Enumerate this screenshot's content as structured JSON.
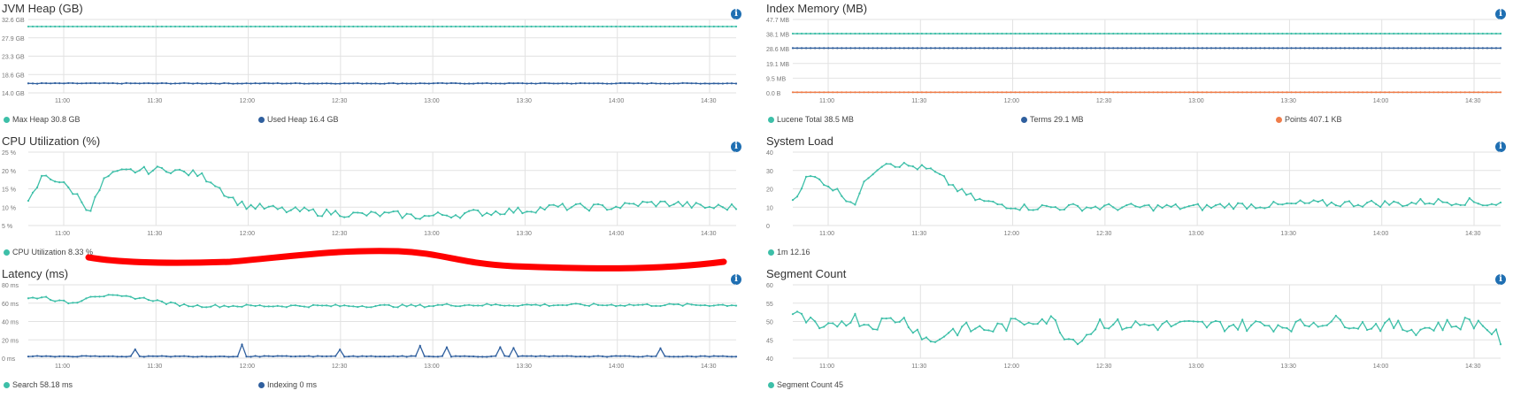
{
  "panels": [
    {
      "id": "jvm-heap",
      "title": "JVM Heap (GB)",
      "chart_data": {
        "type": "line",
        "title": "JVM Heap (GB)",
        "x": [
          "11:00",
          "11:30",
          "12:00",
          "12:30",
          "13:00",
          "13:30",
          "14:00",
          "14:30"
        ],
        "y_ticks": [
          "14.0 GB",
          "18.6 GB",
          "23.3 GB",
          "27.9 GB",
          "32.6 GB"
        ],
        "ylim": [
          14.0,
          32.6
        ],
        "series": [
          {
            "name": "Max Heap",
            "legend": "Max Heap 30.8 GB",
            "color": "#3dbfa8",
            "level": 30.8,
            "noise": 0.0
          },
          {
            "name": "Used Heap",
            "legend": "Used Heap 16.4 GB",
            "color": "#2f5f9e",
            "level": 16.4,
            "noise": 0.18
          }
        ]
      }
    },
    {
      "id": "index-memory",
      "title": "Index Memory (MB)",
      "chart_data": {
        "type": "line",
        "title": "Index Memory (MB)",
        "x": [
          "11:00",
          "11:30",
          "12:00",
          "12:30",
          "13:00",
          "13:30",
          "14:00",
          "14:30"
        ],
        "y_ticks": [
          "0.0 B",
          "9.5 MB",
          "19.1 MB",
          "28.6 MB",
          "38.1 MB",
          "47.7 MB"
        ],
        "ylim": [
          0,
          47.7
        ],
        "series": [
          {
            "name": "Lucene Total",
            "legend": "Lucene Total 38.5 MB",
            "color": "#3dbfa8",
            "level": 38.5,
            "noise": 0.0
          },
          {
            "name": "Terms",
            "legend": "Terms 29.1 MB",
            "color": "#2f5f9e",
            "level": 29.1,
            "noise": 0.0
          },
          {
            "name": "Points",
            "legend": "Points 407.1 KB",
            "color": "#ef7d4a",
            "level": 0.4,
            "noise": 0.0
          }
        ]
      }
    },
    {
      "id": "cpu-utilization",
      "title": "CPU Utilization (%)",
      "chart_data": {
        "type": "line",
        "title": "CPU Utilization (%)",
        "x": [
          "11:00",
          "11:30",
          "12:00",
          "12:30",
          "13:00",
          "13:30",
          "14:00",
          "14:30"
        ],
        "y_ticks": [
          "5 %",
          "10 %",
          "15 %",
          "20 %",
          "25 %"
        ],
        "ylim": [
          5,
          25
        ],
        "series": [
          {
            "name": "CPU Utilization",
            "legend": "CPU Utilization 8.33 %",
            "color": "#3dbfa8",
            "profile": [
              11,
              19,
              17,
              14,
              9,
              18,
              19.5,
              20,
              20,
              20.5,
              19.5,
              19,
              17,
              13,
              10.5,
              10,
              9.5,
              9,
              9,
              8.5,
              8.5,
              8,
              8,
              8,
              8,
              7.5,
              7.5,
              8,
              8,
              8.5,
              8.5,
              9,
              9,
              9.5,
              10,
              10,
              10,
              10,
              10,
              10.5,
              11,
              11,
              11,
              10.5,
              10,
              10,
              10
            ],
            "noise": 2.0
          }
        ]
      }
    },
    {
      "id": "system-load",
      "title": "System Load",
      "chart_data": {
        "type": "line",
        "title": "System Load",
        "x": [
          "11:00",
          "11:30",
          "12:00",
          "12:30",
          "13:00",
          "13:30",
          "14:00",
          "14:30"
        ],
        "y_ticks": [
          "0",
          "10",
          "20",
          "30",
          "40"
        ],
        "ylim": [
          0,
          40
        ],
        "series": [
          {
            "name": "1m",
            "legend": "1m 12.16",
            "color": "#3dbfa8",
            "profile": [
              14,
              27,
              24,
              18,
              12,
              28,
              35,
              33,
              32,
              30,
              24,
              18,
              14,
              12,
              11,
              10,
              10,
              10,
              10,
              10,
              10,
              10,
              10,
              10,
              10,
              10,
              10,
              10,
              11,
              11,
              11,
              11,
              11,
              12,
              12,
              12,
              12,
              12,
              12,
              12,
              12,
              13,
              13,
              13,
              13,
              12,
              12
            ],
            "noise": 4.0
          }
        ]
      }
    },
    {
      "id": "latency",
      "title": "Latency (ms)",
      "chart_data": {
        "type": "line",
        "title": "Latency (ms)",
        "x": [
          "11:00",
          "11:30",
          "12:00",
          "12:30",
          "13:00",
          "13:30",
          "14:00",
          "14:30"
        ],
        "y_ticks": [
          "0 ms",
          "20 ms",
          "40 ms",
          "60 ms",
          "80 ms"
        ],
        "ylim": [
          0,
          80
        ],
        "series": [
          {
            "name": "Search",
            "legend": "Search 58.18 ms",
            "color": "#3dbfa8",
            "profile": [
              65,
              67,
              62,
              60,
              68,
              68,
              67,
              66,
              64,
              60,
              58,
              57,
              57,
              57,
              57,
              57,
              57,
              57,
              57,
              57,
              57,
              57,
              57,
              57,
              57,
              57,
              57,
              58,
              58,
              58,
              58,
              58,
              58,
              58,
              58,
              58,
              58,
              58,
              58,
              58,
              58,
              58,
              58,
              58,
              58,
              58,
              58
            ],
            "noise": 3.0
          },
          {
            "name": "Indexing",
            "legend": "Indexing 0 ms",
            "color": "#2f5f9e",
            "profile": [
              2,
              2,
              2,
              2,
              2,
              2,
              2,
              2,
              2,
              2,
              2,
              2,
              2,
              2,
              2,
              2,
              2,
              2,
              2,
              2,
              2,
              2,
              2,
              2,
              2,
              2,
              2,
              2,
              2,
              2,
              2,
              2,
              2,
              2,
              2,
              2,
              2,
              2,
              2,
              2,
              2,
              2,
              2,
              2,
              2,
              2,
              2
            ],
            "noise": 1.0
          }
        ]
      }
    },
    {
      "id": "segment-count",
      "title": "Segment Count",
      "chart_data": {
        "type": "line",
        "title": "Segment Count",
        "x": [
          "11:00",
          "11:30",
          "12:00",
          "12:30",
          "13:00",
          "13:30",
          "14:00",
          "14:30"
        ],
        "y_ticks": [
          "40",
          "45",
          "50",
          "55",
          "60"
        ],
        "ylim": [
          40,
          60
        ],
        "series": [
          {
            "name": "Segment Count",
            "legend": "Segment Count 45",
            "color": "#3dbfa8",
            "profile": [
              52,
              50,
              47,
              50,
              51,
              49,
              50,
              51,
              48,
              44,
              47,
              48,
              48,
              48,
              49,
              50,
              51,
              50,
              45,
              46,
              50,
              49,
              49,
              49,
              49,
              49,
              49,
              49,
              49,
              49,
              49,
              49,
              49,
              49,
              50,
              50,
              50,
              49,
              49,
              49,
              48,
              48,
              49,
              49,
              50,
              49,
              45
            ],
            "noise": 3.5
          }
        ]
      }
    }
  ],
  "colors": {
    "teal": "#3dbfa8",
    "blue": "#2f5f9e",
    "orange": "#ef7d4a",
    "grid": "#e2e2e2",
    "info": "#1f6fb2",
    "annotation": "#ff0000"
  }
}
